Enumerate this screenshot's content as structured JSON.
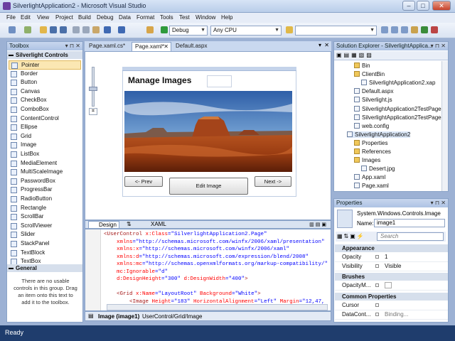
{
  "window": {
    "title": "SilverlightApplication2 - Microsoft Visual Studio"
  },
  "menu": [
    "File",
    "Edit",
    "View",
    "Project",
    "Build",
    "Debug",
    "Data",
    "Format",
    "Tools",
    "Test",
    "Window",
    "Help"
  ],
  "toolbar": {
    "config": "Debug",
    "platform": "Any CPU"
  },
  "toolbox": {
    "title": "Toolbox",
    "group": "Silverlight Controls",
    "items": [
      "Pointer",
      "Border",
      "Button",
      "Canvas",
      "CheckBox",
      "ComboBox",
      "ContentControl",
      "Ellipse",
      "Grid",
      "Image",
      "ListBox",
      "MediaElement",
      "MultiScaleImage",
      "PasswordBox",
      "ProgressBar",
      "RadioButton",
      "Rectangle",
      "ScrollBar",
      "ScrollViewer",
      "Slider",
      "StackPanel",
      "TextBlock",
      "TextBox"
    ],
    "general": "General",
    "empty_text": "There are no usable controls in this group. Drag an item onto this text to add it to the toolbox."
  },
  "tabs": [
    "Page.xaml.cs*",
    "Page.xaml*",
    "Default.aspx"
  ],
  "designer": {
    "heading": "Manage Images",
    "prev": "<- Prev",
    "edit": "Edit Image",
    "next": "Next ->"
  },
  "split": {
    "design": "Design",
    "swap": "⇅",
    "xaml": "XAML"
  },
  "xaml_lines": [
    [
      [
        "t",
        "<UserControl "
      ],
      [
        "a",
        "x:Class"
      ],
      [
        "v",
        "=\"SilverlightApplication2.Page\""
      ]
    ],
    [
      [
        "a",
        "    xmlns"
      ],
      [
        "v",
        "=\"http://schemas.microsoft.com/winfx/2006/xaml/presentation\""
      ]
    ],
    [
      [
        "a",
        "    xmlns:x"
      ],
      [
        "v",
        "=\"http://schemas.microsoft.com/winfx/2006/xaml\""
      ]
    ],
    [
      [
        "a",
        "    xmlns:d"
      ],
      [
        "v",
        "=\"http://schemas.microsoft.com/expression/blend/2008\""
      ]
    ],
    [
      [
        "a",
        "    xmlns:mc"
      ],
      [
        "v",
        "=\"http://schemas.openxmlformats.org/markup-compatibility/\""
      ]
    ],
    [
      [
        "a",
        "    mc:Ignorable"
      ],
      [
        "v",
        "=\"d\""
      ]
    ],
    [
      [
        "a",
        "    d:DesignHeight"
      ],
      [
        "v",
        "=\"300\" "
      ],
      [
        "a",
        "d:DesignWidth"
      ],
      [
        "v",
        "=\"400\""
      ],
      [
        "t",
        ">"
      ]
    ],
    [
      [
        "t",
        ""
      ]
    ],
    [
      [
        "t",
        "    <Grid "
      ],
      [
        "a",
        "x:Name"
      ],
      [
        "v",
        "=\"LayoutRoot\" "
      ],
      [
        "a",
        "Background"
      ],
      [
        "v",
        "=\"White\""
      ],
      [
        "t",
        ">"
      ]
    ],
    [
      [
        "t",
        "        <Image "
      ],
      [
        "a",
        "Height"
      ],
      [
        "v",
        "=\"183\" "
      ],
      [
        "a",
        "HorizontalAlignment"
      ],
      [
        "v",
        "=\"Left\" "
      ],
      [
        "a",
        "Margin"
      ],
      [
        "v",
        "=\"12,47,"
      ]
    ]
  ],
  "breadcrumb": {
    "element": "Image (image1)",
    "path": "UserControl/Grid/Image"
  },
  "solution_explorer": {
    "title": "Solution Explorer - SilverlightApplica...",
    "items": [
      {
        "label": "Bin",
        "indent": 2,
        "type": "folder"
      },
      {
        "label": "ClientBin",
        "indent": 2,
        "type": "folder"
      },
      {
        "label": "SilverlightApplication2.xap",
        "indent": 3,
        "type": "file"
      },
      {
        "label": "Default.aspx",
        "indent": 2,
        "type": "file"
      },
      {
        "label": "Silverlight.js",
        "indent": 2,
        "type": "file"
      },
      {
        "label": "SilverlightApplication2TestPage.",
        "indent": 2,
        "type": "file"
      },
      {
        "label": "SilverlightApplication2TestPage.",
        "indent": 2,
        "type": "file"
      },
      {
        "label": "web.config",
        "indent": 2,
        "type": "file"
      },
      {
        "label": "SilverlightApplication2",
        "indent": 1,
        "type": "project"
      },
      {
        "label": "Properties",
        "indent": 2,
        "type": "folder"
      },
      {
        "label": "References",
        "indent": 2,
        "type": "folder"
      },
      {
        "label": "Images",
        "indent": 2,
        "type": "folder"
      },
      {
        "label": "Desert.jpg",
        "indent": 3,
        "type": "file"
      },
      {
        "label": "App.xaml",
        "indent": 2,
        "type": "file"
      },
      {
        "label": "Page.xaml",
        "indent": 2,
        "type": "file"
      }
    ]
  },
  "properties": {
    "title": "Properties",
    "type": "System.Windows.Controls.Image",
    "name_label": "Name:",
    "name_value": "image1",
    "search_placeholder": "Search",
    "appearance": "Appearance",
    "opacity_k": "Opacity",
    "opacity_v": "1",
    "visibility_k": "Visibility",
    "visibility_v": "Visible",
    "brushes": "Brushes",
    "opacitymask_k": "OpacityM...",
    "common": "Common Properties",
    "cursor_k": "Cursor",
    "datacontext_k": "DataCont...",
    "datacontext_v": "Binding..."
  },
  "status": "Ready"
}
